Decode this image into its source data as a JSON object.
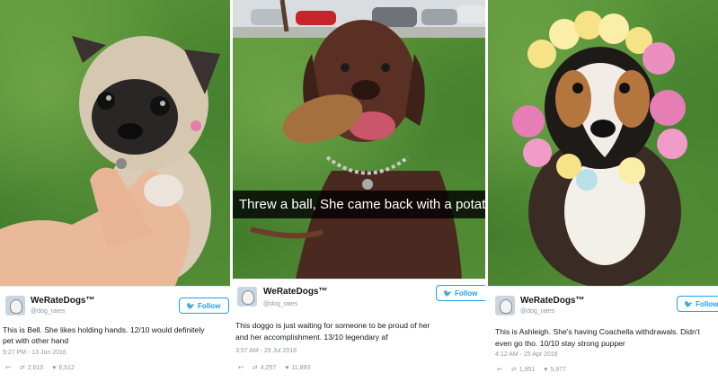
{
  "cards": [
    {
      "name": "WeRateDogs™",
      "handle": "@dog_rates",
      "follow_label": "Follow",
      "text_line1": "This is Bell. She likes holding hands. 12/10 would definitely",
      "text_line2": "pet with other hand",
      "time": "9:27 PM - 13 Jun 2016",
      "retweets": "2,610",
      "likes": "6,512"
    },
    {
      "name": "WeRateDogs™",
      "handle": "@dog_rates",
      "follow_label": "Follow",
      "caption": "Threw a ball, She came back with a potato",
      "text_line1": "This doggo is just waiting for someone to be proud of her",
      "text_line2": "and her accomplishment. 13/10 legendary af",
      "time": "3:57 AM - 29 Jul 2016",
      "retweets": "4,257",
      "likes": "11,893"
    },
    {
      "name": "WeRateDogs™",
      "handle": "@dog_rates",
      "follow_label": "Follow",
      "text_line1": "This is Ashleigh. She's having Coachella withdrawals. Didn't",
      "text_line2": "even go tho. 10/10 stay strong pupper",
      "time": "4:12 AM - 25 Apr 2016",
      "retweets": "1,951",
      "likes": "5,977"
    }
  ],
  "colors": {
    "twitter_blue": "#1da1f2",
    "meta_gray": "#8899a6",
    "text": "#14171a"
  },
  "icons": [
    "twitter-bird-icon",
    "reply-icon",
    "retweet-icon",
    "heart-icon"
  ]
}
